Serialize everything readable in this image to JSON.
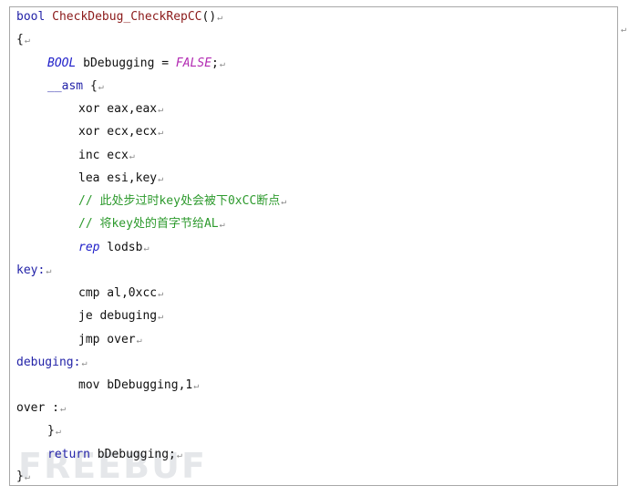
{
  "code": {
    "line1": {
      "kw": "bool",
      "fn": "CheckDebug_CheckRepCC",
      "rest": "()",
      "mark": "↵"
    },
    "line2": {
      "text": "{",
      "mark": "↵"
    },
    "line3": {
      "type": "BOOL",
      "var": " bDebugging = ",
      "value": "FALSE",
      "rest": ";",
      "mark": "↵"
    },
    "line4": {
      "kw": "__asm",
      "rest": " {",
      "mark": "↵"
    },
    "line5": {
      "text": "xor eax,eax",
      "mark": "↵"
    },
    "line6": {
      "text": "xor ecx,ecx",
      "mark": "↵"
    },
    "line7": {
      "text": "inc ecx",
      "mark": "↵"
    },
    "line8": {
      "text": "lea esi,key",
      "mark": "↵"
    },
    "line9": {
      "comment": "// 此处步过时key处会被下0xCC断点",
      "mark": "↵"
    },
    "line10": {
      "comment": "// 将key处的首字节给AL",
      "mark": "↵"
    },
    "line11": {
      "kw": "rep",
      "rest": " lodsb",
      "mark": "↵"
    },
    "line12": {
      "label": "key:",
      "mark": "↵"
    },
    "line13": {
      "text": "cmp al,0xcc",
      "mark": "↵"
    },
    "line14": {
      "text": "je debuging",
      "mark": "↵"
    },
    "line15": {
      "text": "jmp over",
      "mark": "↵"
    },
    "line16": {
      "label": "debuging:",
      "mark": "↵"
    },
    "line17": {
      "text": "mov bDebugging,1",
      "mark": "↵"
    },
    "line18": {
      "label": "over :",
      "mark": "↵"
    },
    "line19": {
      "text": "}",
      "mark": "↵"
    },
    "line20": {
      "kw": "return",
      "rest": " bDebugging;",
      "mark": "↵"
    },
    "line21": {
      "text": "}",
      "mark": "↵"
    }
  },
  "outer_mark": "↵",
  "watermark": "FREEBUF",
  "colors": {
    "keyword": "#2323a8",
    "function": "#8b1a1a",
    "type": "#1f1fc9",
    "constant": "#b22ab2",
    "comment": "#2d9a2d",
    "border": "#a8a8a8"
  }
}
